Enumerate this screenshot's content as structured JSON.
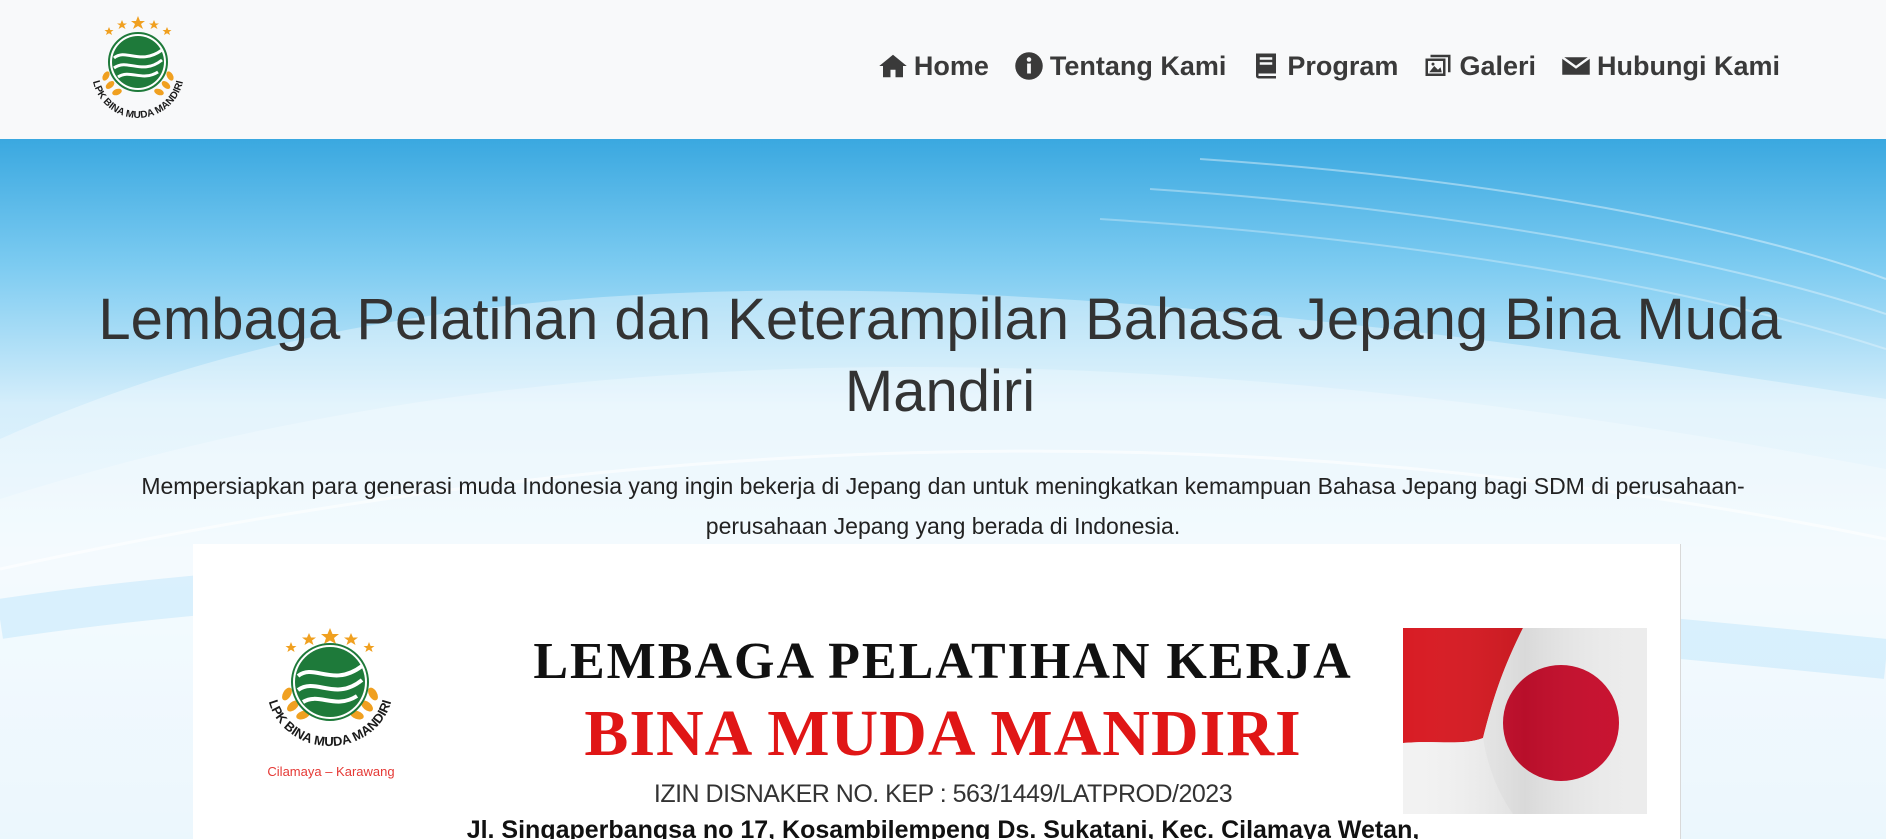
{
  "brand": {
    "logo_text": "LPK BINA MUDA MANDIRI"
  },
  "nav": {
    "items": [
      {
        "label": "Home",
        "icon": "home-icon"
      },
      {
        "label": "Tentang Kami",
        "icon": "info-icon"
      },
      {
        "label": "Program",
        "icon": "book-icon"
      },
      {
        "label": "Galeri",
        "icon": "images-icon"
      },
      {
        "label": "Hubungi Kami",
        "icon": "envelope-icon"
      }
    ]
  },
  "hero": {
    "title": "Lembaga Pelatihan dan Keterampilan Bahasa Jepang Bina Muda Mandiri",
    "subtitle": "Mempersiapkan para generasi muda Indonesia yang ingin bekerja di Jepang dan untuk meningkatkan kemampuan Bahasa Jepang bagi SDM di perusahaan-perusahaan Jepang yang berada di Indonesia."
  },
  "banner": {
    "heading": "LEMBAGA PELATIHAN KERJA",
    "name": "BINA MUDA MANDIRI",
    "license": "IZIN DISNAKER NO. KEP : 563/1449/LATPROD/2023",
    "address": "Jl. Singaperbangsa no 17, Kosambilempeng Ds. Sukatani, Kec. Cilamaya Wetan,",
    "location": "Cilamaya – Karawang",
    "logo_text": "LPK BINA MUDA MANDIRI"
  },
  "colors": {
    "nav_text": "#3a3a3a",
    "hero_top": "#3aa8e0",
    "banner_red": "#e01616",
    "logo_green": "#1e7a3a",
    "logo_gold": "#f0a020"
  }
}
